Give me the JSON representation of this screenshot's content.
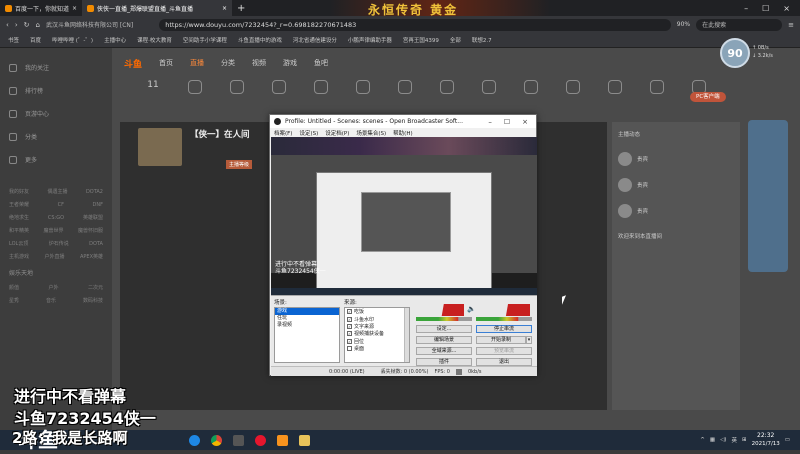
{
  "browser": {
    "tabs": [
      {
        "label": "百度一下，你就知道",
        "active": false
      },
      {
        "label": "侠侠一直播_郑爆联盟直播_斗鱼直播",
        "active": true
      }
    ],
    "url": "https://www.douyu.com/7232454?_r=0.698182270671483",
    "zoom": "90%",
    "search_label": "在此搜索",
    "site_security": "武汉斗鱼网络科技有限公司 [CN]",
    "bookmarks": [
      "书签",
      "百度",
      "哔哩哔哩 (゜-゜)",
      "主播中心",
      "课程·校大教育",
      "空间助手小学课程",
      "斗鱼直播中的游戏",
      "河北省通信建设分",
      "小鹏声律编助手器",
      "宫再王国4399",
      "全部",
      "联想2.7"
    ],
    "banner_text": "永恒传奇 黄金"
  },
  "site": {
    "logo": "斗鱼",
    "nav": [
      "首页",
      "直播",
      "分类",
      "视频",
      "游戏",
      "鱼吧"
    ],
    "user_level": "90",
    "net_speed": [
      "↑ 0B/s",
      "↓ 3.2k/s"
    ],
    "left_nav": [
      {
        "label": "我的关注"
      },
      {
        "label": "排行榜"
      },
      {
        "label": "页游中心"
      },
      {
        "label": "分类"
      },
      {
        "label": "更多"
      }
    ],
    "left_rows": [
      [
        "我的好友",
        "偶遇主播",
        "DOTA2"
      ],
      [
        "王者荣耀",
        "CF",
        "DNF"
      ],
      [
        "绝地求生",
        "CS:GO",
        "英雄联盟"
      ],
      [
        "和平精英",
        "魔兽世界",
        "魔兽怀旧服"
      ],
      [
        "LOL云顶",
        "炉石传说",
        "DOTA"
      ],
      [
        "主机游戏",
        "户外直播",
        "APEX英雄"
      ]
    ],
    "left_section": "娱乐天地",
    "left_rows2": [
      [
        "颜值",
        "户外",
        "二次元"
      ],
      [
        "星秀",
        "音乐",
        "数码科技"
      ]
    ],
    "quick_icons": [
      "",
      "",
      "",
      "",
      "",
      "",
      "",
      "",
      "",
      "",
      "",
      "",
      "",
      ""
    ],
    "follow_count": "11",
    "room_title": "【侠一】在人间",
    "room_tag": "主播等级",
    "right_panel_rows": [
      "主播动态",
      "贵宾",
      "贵宾",
      "贵宾",
      "欢迎来到本直播间"
    ],
    "promo_label": "PC客户端"
  },
  "obs": {
    "title": "Profile: Untitled - Scenes: scenes - Open Broadcaster Soft...",
    "menu": [
      "档案(F)",
      "设定(S)",
      "设定档(P)",
      "场景集合(S)",
      "帮助(H)"
    ],
    "scenes_label": "场景:",
    "scenes": [
      "游戏",
      "任玩",
      "录视频"
    ],
    "sources_label": "来源:",
    "sources": [
      {
        "name": "吃饭",
        "checked": true
      },
      {
        "name": "斗鱼水印",
        "checked": true
      },
      {
        "name": "文字来源",
        "checked": true
      },
      {
        "name": "视频捕获设备",
        "checked": true
      },
      {
        "name": "回位",
        "checked": true
      },
      {
        "name": "桌面",
        "checked": false
      }
    ],
    "buttons": [
      "设定...",
      "停止串流",
      "编辑场景",
      "开始录制",
      "全域来源...",
      "预览串流",
      "插件",
      "退出"
    ],
    "disabled_buttons": [
      "预览串流"
    ],
    "status": {
      "time": "0:00:00 (LIVE)",
      "dropped": "丢失帧数: 0 (0.00%)",
      "fps": "FPS: 0",
      "bitrate": "0kb/s"
    }
  },
  "overlay": {
    "line1": "进行中不看弹幕",
    "line2": "斗鱼7232454侠一",
    "line3": "2路：我是长路啊",
    "logo": "斗鱼"
  },
  "taskbar": {
    "apps": [
      "ie",
      "chrome",
      "task",
      "edge",
      "store",
      "obs",
      "weibo",
      "unknown",
      "files"
    ],
    "ime": "英",
    "time": "22:32",
    "date": "2021/7/13"
  }
}
